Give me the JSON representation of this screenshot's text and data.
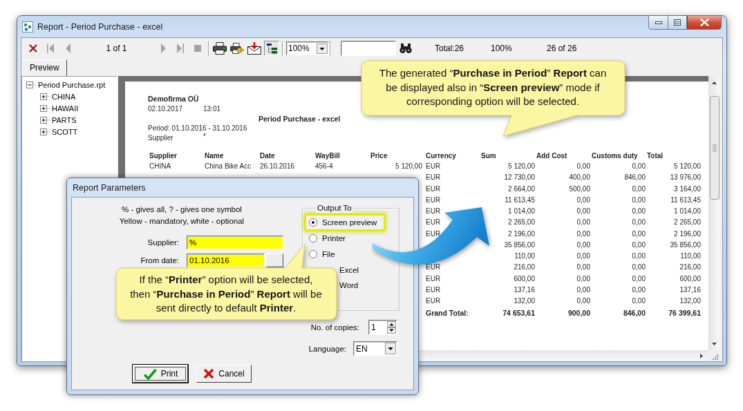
{
  "window": {
    "title": "Report - Period Purchase - excel"
  },
  "toolbar": {
    "groups": [
      [
        {
          "kind": "close",
          "disabled": false,
          "pressed": false
        },
        {
          "kind": "first",
          "disabled": true,
          "pressed": false
        },
        {
          "kind": "previous",
          "disabled": true,
          "pressed": false
        },
        {
          "kind": "page_label",
          "text": "1 of 1"
        },
        {
          "kind": "next",
          "disabled": true,
          "pressed": false
        },
        {
          "kind": "last",
          "disabled": true,
          "pressed": false
        },
        {
          "kind": "stop",
          "disabled": true,
          "pressed": false
        }
      ],
      [
        {
          "kind": "print",
          "disabled": false,
          "pressed": false
        },
        {
          "kind": "print_setup",
          "disabled": false,
          "pressed": false
        },
        {
          "kind": "export",
          "disabled": false,
          "pressed": false
        },
        {
          "kind": "tree",
          "disabled": false,
          "pressed": true
        }
      ],
      [
        {
          "kind": "zoom_select",
          "value": "100%"
        }
      ],
      [
        {
          "kind": "search_field"
        },
        {
          "kind": "find",
          "disabled": false,
          "pressed": false
        },
        {
          "kind": "label",
          "text": "Total:26"
        },
        {
          "kind": "label",
          "text": "100%"
        },
        {
          "kind": "label",
          "text": "26 of 26"
        }
      ]
    ]
  },
  "tabs": [
    {
      "label": "Preview",
      "selected": true
    }
  ],
  "tree": {
    "label": "Period Purchase.rpt",
    "expanded": true,
    "children": [
      {
        "label": "CHINA",
        "expanded": false
      },
      {
        "label": "HAWAII",
        "expanded": false
      },
      {
        "label": "PARTS",
        "expanded": false
      },
      {
        "label": "SCOTT",
        "expanded": false
      }
    ]
  },
  "report": {
    "company": "Demofirma OÜ",
    "date": "02.10.2017",
    "time": "13:01",
    "title": "Period Purchase - excel",
    "period": "Period: 01.10.2016 - 31.10.2016",
    "filter": {
      "label": "Supplier",
      "value": "*"
    },
    "columns": [
      "Supplier",
      "Name",
      "Date",
      "WayBill",
      "Price",
      "Currency",
      "Sum",
      "Add Cost",
      "Customs duty",
      "Total"
    ],
    "rows": [
      {
        "supplier": "CHINA",
        "name": "China Bike Acc",
        "date": "26.10.2016",
        "waybill": "456-4",
        "price": "5 120,00",
        "currency": "EUR",
        "sum": "5 120,00",
        "add_cost": "0,00",
        "customs_duty": "0,00",
        "total": "5 120,00"
      },
      {
        "currency": "EUR",
        "sum": "12 730,00",
        "add_cost": "400,00",
        "customs_duty": "846,00",
        "total": "13 976,00"
      },
      {
        "currency": "EUR",
        "sum": "2 664,00",
        "add_cost": "500,00",
        "customs_duty": "0,00",
        "total": "3 164,00"
      },
      {
        "currency": "EUR",
        "sum": "11 613,45",
        "add_cost": "0,00",
        "customs_duty": "0,00",
        "total": "11 613,45"
      },
      {
        "currency": "EUR",
        "sum": "1 014,00",
        "add_cost": "0,00",
        "customs_duty": "0,00",
        "total": "1 014,00"
      },
      {
        "currency": "EUR",
        "sum": "2 265,00",
        "add_cost": "0,00",
        "customs_duty": "0,00",
        "total": "2 265,00"
      },
      {
        "currency": "EUR",
        "sum": "2 196,00",
        "add_cost": "0,00",
        "customs_duty": "0,00",
        "total": "2 196,00"
      },
      {
        "sum": "35 856,00",
        "add_cost": "0,00",
        "customs_duty": "0,00",
        "total": "35 856,00"
      },
      {
        "sum": "110,00",
        "add_cost": "0,00",
        "customs_duty": "0,00",
        "total": "110,00"
      },
      {
        "currency": "EUR",
        "sum": "216,00",
        "add_cost": "0,00",
        "customs_duty": "0,00",
        "total": "216,00"
      },
      {
        "currency": "EUR",
        "sum": "600,00",
        "add_cost": "0,00",
        "customs_duty": "0,00",
        "total": "600,00"
      },
      {
        "currency": "EUR",
        "sum": "137,16",
        "add_cost": "0,00",
        "customs_duty": "0,00",
        "total": "137,16"
      },
      {
        "currency": "EUR",
        "sum": "132,00",
        "add_cost": "0,00",
        "customs_duty": "0,00",
        "total": "132,00"
      }
    ],
    "grand_total": {
      "label": "Grand Total:",
      "sum": "74 653,61",
      "add_cost": "900,00",
      "customs_duty": "846,00",
      "total": "76 399,61"
    }
  },
  "dialog": {
    "title": "Report Parameters",
    "hints": [
      "% - gives all, ? - gives one symbol",
      "Yellow - mandatory, white - optional"
    ],
    "fields": [
      {
        "kind": "text",
        "label": "Supplier:",
        "value": "%",
        "mandatory": true
      },
      {
        "kind": "date",
        "label": "From date:",
        "value": "01.10.2016",
        "mandatory": true
      }
    ],
    "output": {
      "title": "Output To",
      "options": [
        {
          "label": "Screen preview",
          "selected": true
        },
        {
          "label": "Printer",
          "selected": false
        },
        {
          "label": "File",
          "selected": false
        }
      ],
      "partly_covered_options": [
        "Excel",
        "Word"
      ]
    },
    "copies": {
      "label": "No. of copies:",
      "value": "1"
    },
    "language": {
      "label": "Language:",
      "value": "EN"
    },
    "buttons": [
      {
        "kind": "confirm",
        "label": "Print",
        "default": true
      },
      {
        "kind": "cancel",
        "label": "Cancel",
        "default": false
      }
    ]
  },
  "callouts": [
    {
      "text": "The generated “**Purchase in Period**” **Report** can be displayed also in “**Screen preview**” mode if corresponding option will be selected."
    },
    {
      "text": "If the “**Printer**” option will be selected, then “**Purchase in Period**” **Report** will be sent directly to default **Printer**."
    }
  ]
}
